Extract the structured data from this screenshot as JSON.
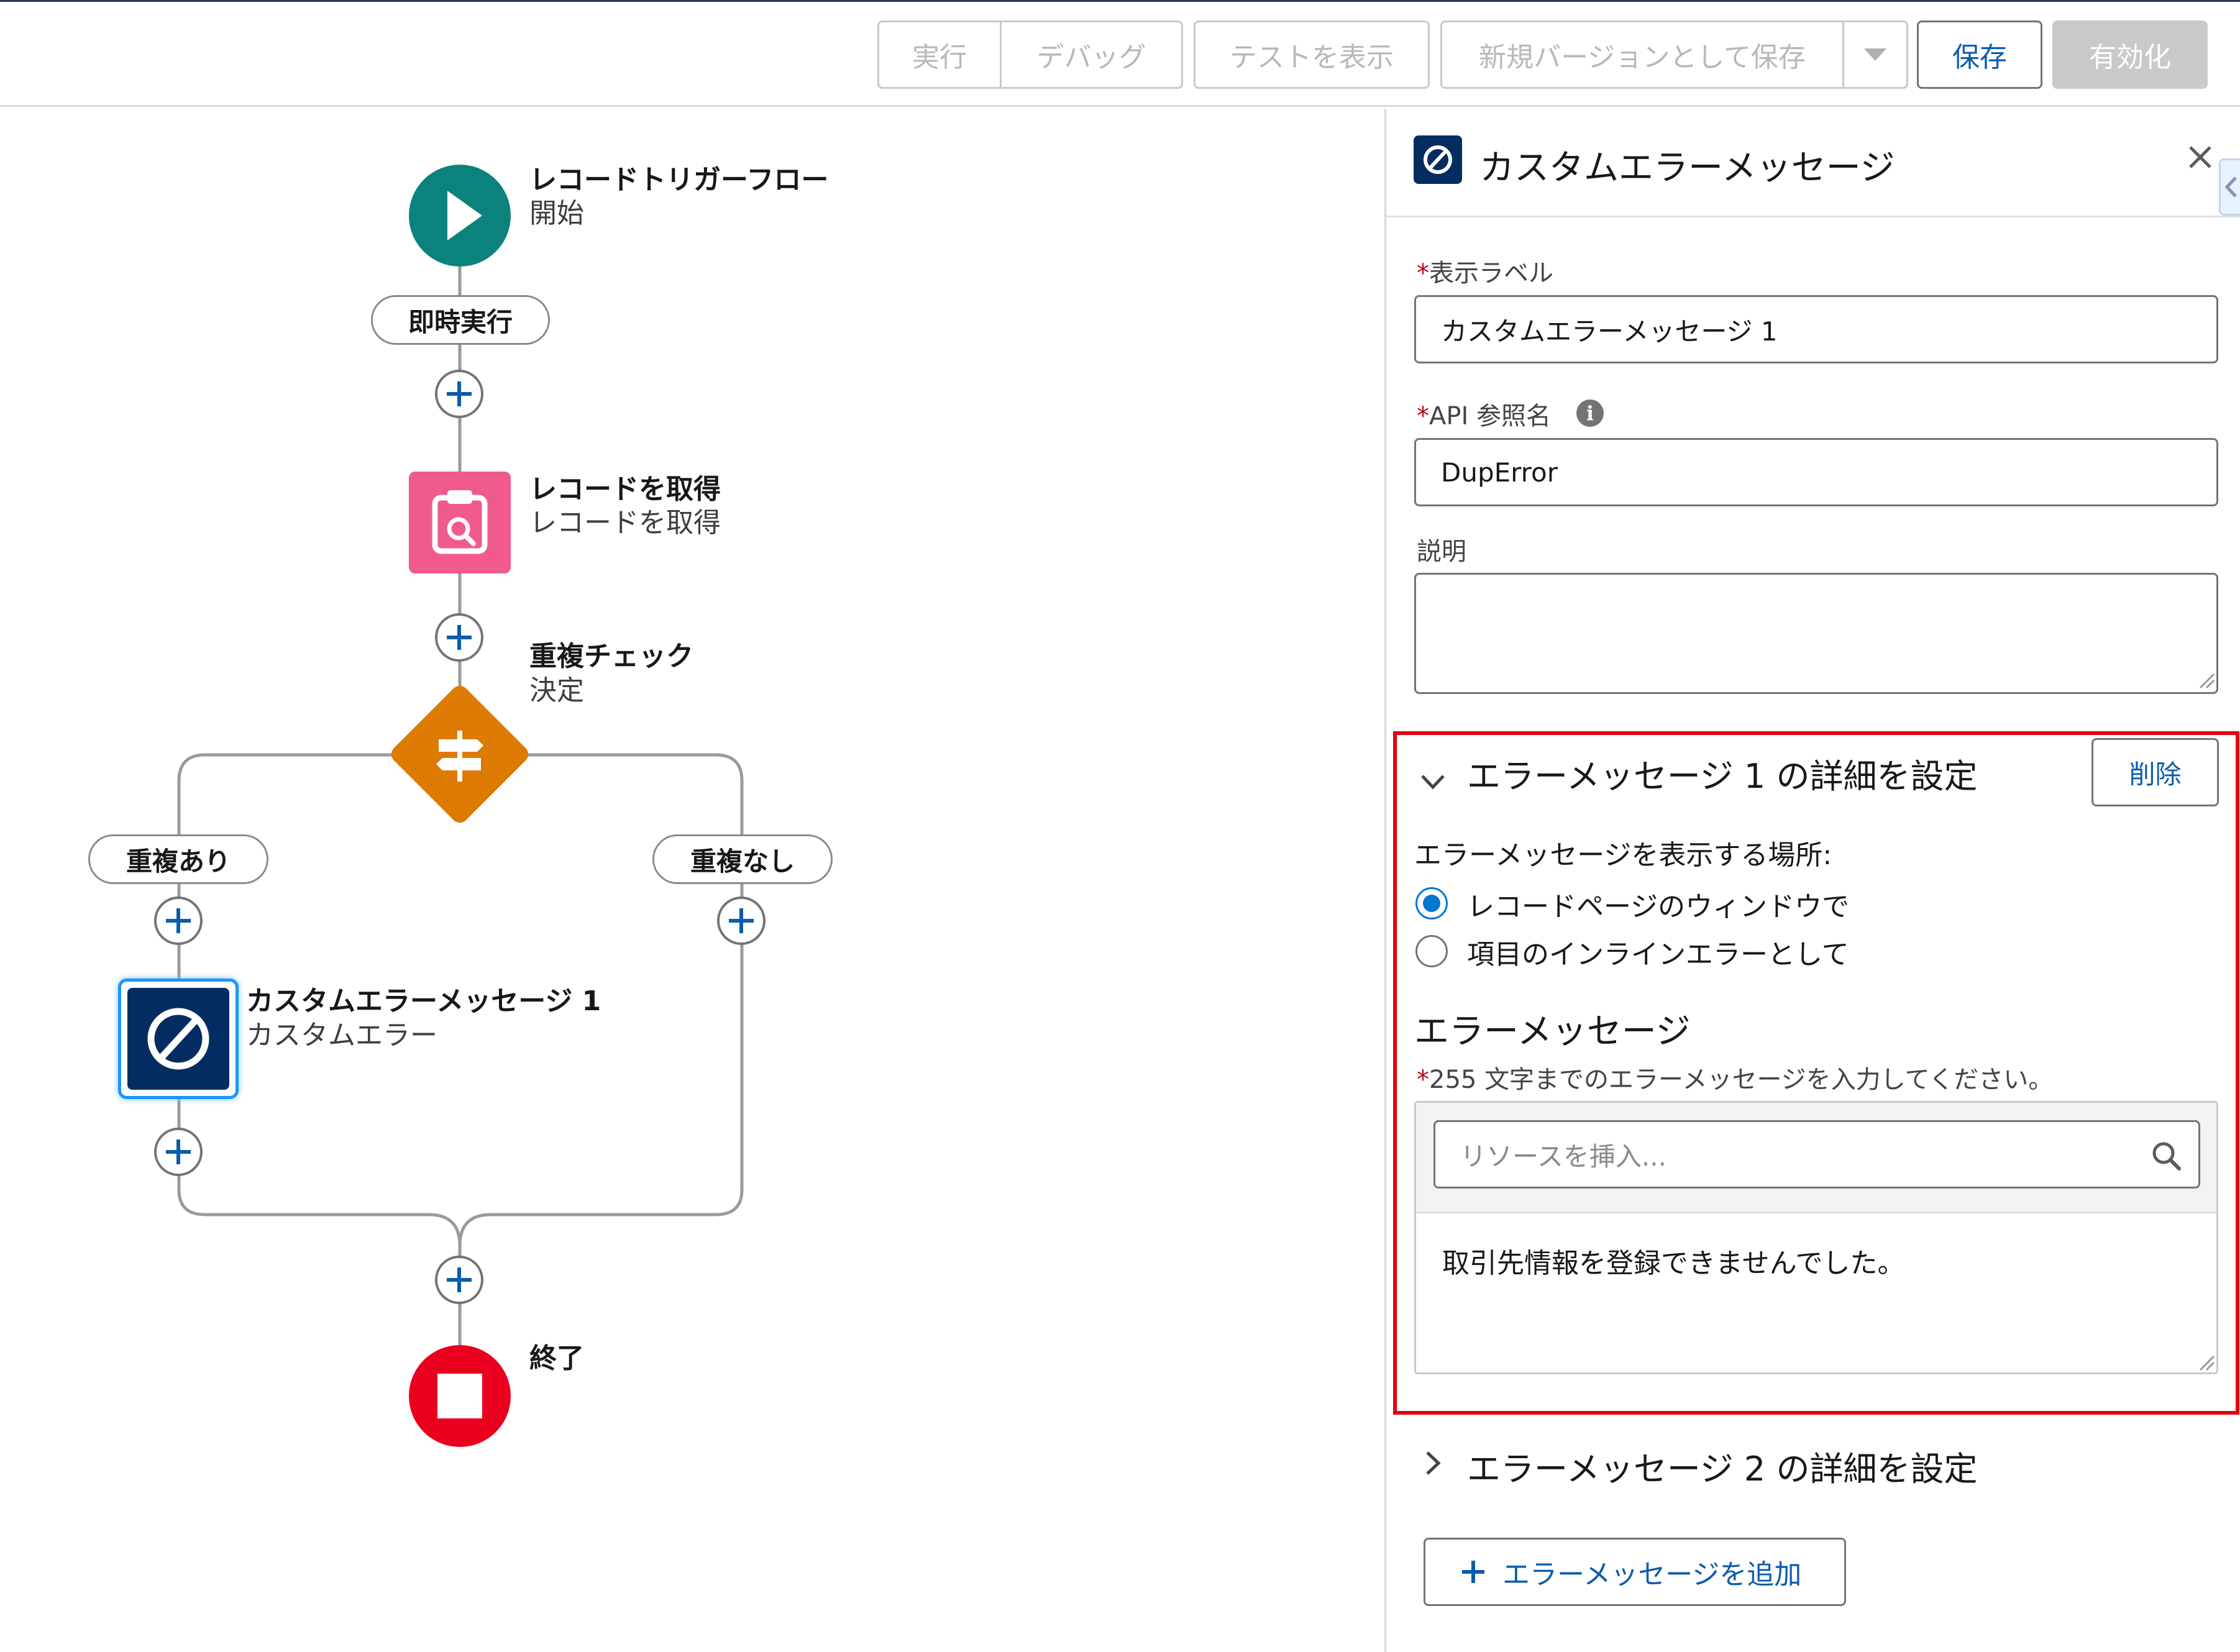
{
  "toolbar": {
    "run": "実行",
    "debug": "デバッグ",
    "show_tests": "テストを表示",
    "save_as_new_version": "新規バージョンとして保存",
    "save": "保存",
    "activate": "有効化"
  },
  "flow": {
    "start": {
      "title": "レコードトリガーフロー",
      "subtitle": "開始"
    },
    "immediate_path": "即時実行",
    "get_records": {
      "title": "レコードを取得",
      "subtitle": "レコードを取得"
    },
    "decision": {
      "title": "重複チェック",
      "subtitle": "決定"
    },
    "branch_left": "重複あり",
    "branch_right": "重複なし",
    "custom_error": {
      "title": "カスタムエラーメッセージ 1",
      "subtitle": "カスタムエラー"
    },
    "end": {
      "title": "終了"
    }
  },
  "panel": {
    "header_title": "カスタムエラーメッセージ",
    "close_icon": "close-icon",
    "label_field": {
      "label": "表示ラベル",
      "value": "カスタムエラーメッセージ 1"
    },
    "api_name_field": {
      "label": "API 参照名",
      "value": "DupError"
    },
    "description_field": {
      "label": "説明",
      "value": ""
    },
    "section1": {
      "title": "エラーメッセージ 1 の詳細を設定",
      "delete_label": "削除",
      "location_label": "エラーメッセージを表示する場所:",
      "options": [
        "レコードページのウィンドウで",
        "項目のインラインエラーとして"
      ],
      "selected_option": 0,
      "message_heading": "エラーメッセージ",
      "message_help": "255 文字までのエラーメッセージを入力してください。",
      "resource_placeholder": "リソースを挿入...",
      "message_value": "取引先情報を登録できませんでした。"
    },
    "section2": {
      "title": "エラーメッセージ 2 の詳細を設定"
    },
    "add_message_label": "エラーメッセージを追加"
  },
  "colors": {
    "start": "#0b827c",
    "get_records": "#f05a8c",
    "decision": "#dd7a01",
    "custom_error": "#032d60",
    "end": "#ea001e",
    "highlight": "#e3000f",
    "brand": "#0176d3"
  }
}
